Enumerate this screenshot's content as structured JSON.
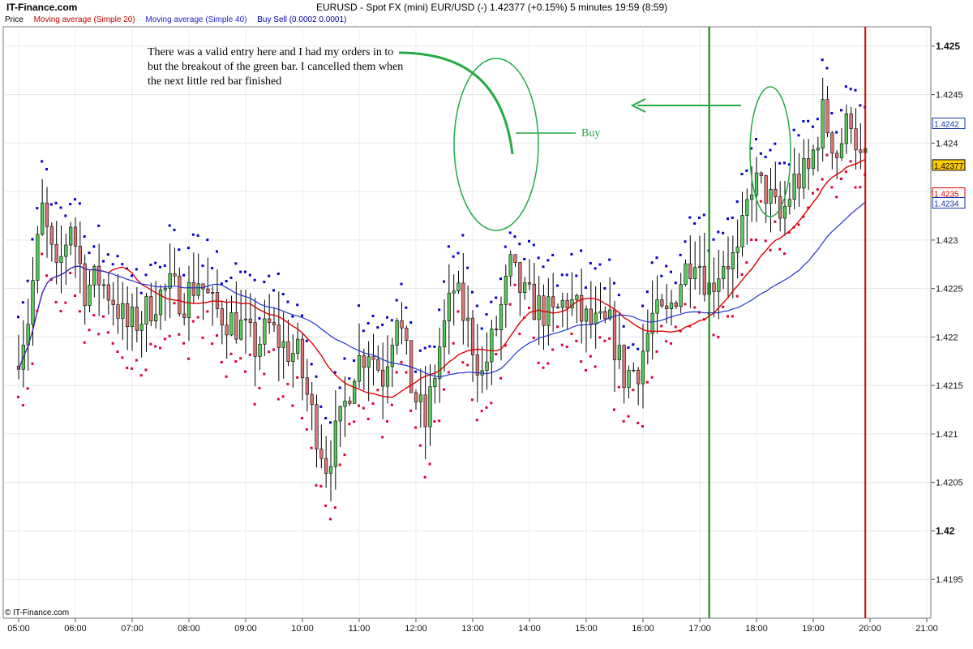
{
  "header": {
    "brand": "IT-Finance.com",
    "title": "EURUSD - Spot FX (mini) EUR/USD (-)    1.42377 (+0.15%)    5 minutes  19:59 (8:59)"
  },
  "legend": {
    "price": "Price",
    "sma20": "Moving average (Simple 20)",
    "sma40": "Moving average (Simple 40)",
    "buysell": "Buy Sell (0.0002 0.0001)"
  },
  "footer": {
    "copyright": "© IT-Finance.com"
  },
  "annotations": {
    "note": "There was a valid entry here and I had my orders in to but the breakout of the green bar.  I cancelled them when the next little red bar finished",
    "buy": "Buy"
  },
  "colors": {
    "bull": "#55cc55",
    "bear": "#dd7777",
    "sma20": "#dd0000",
    "sma40": "#2233cc",
    "buy_dot": "#0000cc",
    "sell_dot": "#dd0033",
    "marker_green": "#008800",
    "marker_red": "#dd0000",
    "annotation": "#22aa44"
  },
  "chart_data": {
    "type": "candlestick",
    "symbol": "EURUSD",
    "interval": "5 minutes",
    "ylim": [
      1.4191,
      1.4252
    ],
    "y_ticks": [
      "1.425",
      "1.4245",
      "1.424",
      "1.4235",
      "1.423",
      "1.4225",
      "1.422",
      "1.4215",
      "1.421",
      "1.4205",
      "1.42",
      "1.4195"
    ],
    "x_ticks": [
      "05:00",
      "06:00",
      "07:00",
      "08:00",
      "09:00",
      "10:00",
      "11:00",
      "12:00",
      "13:00",
      "14:00",
      "15:00",
      "16:00",
      "17:00",
      "18:00",
      "19:00",
      "20:00",
      "21:00"
    ],
    "price_labels": [
      {
        "value": 1.4242,
        "text": "1.4242",
        "color": "#1133aa",
        "fill": "#ffffff"
      },
      {
        "value": 1.42377,
        "text": "1.42377",
        "color": "#000000",
        "fill": "#ffcc00"
      },
      {
        "value": 1.42348,
        "text": "1.4235",
        "color": "#dd0000",
        "fill": "#ffffff"
      },
      {
        "value": 1.42338,
        "text": "1.4234",
        "color": "#1133aa",
        "fill": "#ffffff"
      }
    ],
    "vertical_markers": [
      {
        "time": "17:10",
        "color": "#008800"
      },
      {
        "time": "19:55",
        "color": "#dd0000"
      }
    ],
    "anchors": [
      [
        "05:00",
        1.4217
      ],
      [
        "05:15",
        1.4222
      ],
      [
        "05:30",
        1.4233
      ],
      [
        "05:45",
        1.4226
      ],
      [
        "06:00",
        1.4232
      ],
      [
        "06:15",
        1.4225
      ],
      [
        "06:30",
        1.4226
      ],
      [
        "06:45",
        1.4224
      ],
      [
        "07:00",
        1.4221
      ],
      [
        "07:15",
        1.4222
      ],
      [
        "07:30",
        1.4224
      ],
      [
        "07:45",
        1.4225
      ],
      [
        "08:00",
        1.4224
      ],
      [
        "08:15",
        1.4226
      ],
      [
        "08:30",
        1.4223
      ],
      [
        "08:45",
        1.4222
      ],
      [
        "09:00",
        1.4221
      ],
      [
        "09:15",
        1.4219
      ],
      [
        "09:30",
        1.4221
      ],
      [
        "09:45",
        1.4219
      ],
      [
        "10:00",
        1.4218
      ],
      [
        "10:15",
        1.4212
      ],
      [
        "10:30",
        1.4207
      ],
      [
        "10:45",
        1.4211
      ],
      [
        "11:00",
        1.4217
      ],
      [
        "11:15",
        1.4219
      ],
      [
        "11:30",
        1.4216
      ],
      [
        "11:45",
        1.4223
      ],
      [
        "12:00",
        1.4215
      ],
      [
        "12:15",
        1.4211
      ],
      [
        "12:30",
        1.4219
      ],
      [
        "12:45",
        1.4225
      ],
      [
        "13:00",
        1.4221
      ],
      [
        "13:15",
        1.4216
      ],
      [
        "13:30",
        1.4221
      ],
      [
        "13:45",
        1.4227
      ],
      [
        "14:00",
        1.4224
      ],
      [
        "14:15",
        1.4223
      ],
      [
        "14:30",
        1.4222
      ],
      [
        "14:45",
        1.4224
      ],
      [
        "15:00",
        1.4222
      ],
      [
        "15:15",
        1.4221
      ],
      [
        "15:30",
        1.4221
      ],
      [
        "15:45",
        1.4216
      ],
      [
        "16:00",
        1.4217
      ],
      [
        "16:15",
        1.4222
      ],
      [
        "16:30",
        1.4222
      ],
      [
        "16:45",
        1.4226
      ],
      [
        "17:00",
        1.4229
      ],
      [
        "17:15",
        1.4225
      ],
      [
        "17:30",
        1.4228
      ],
      [
        "17:45",
        1.4228
      ],
      [
        "18:00",
        1.4236
      ],
      [
        "18:15",
        1.4235
      ],
      [
        "18:30",
        1.4232
      ],
      [
        "18:45",
        1.4236
      ],
      [
        "19:00",
        1.4237
      ],
      [
        "19:15",
        1.4243
      ],
      [
        "19:30",
        1.4239
      ],
      [
        "19:45",
        1.4243
      ],
      [
        "19:55",
        1.4238
      ]
    ]
  }
}
